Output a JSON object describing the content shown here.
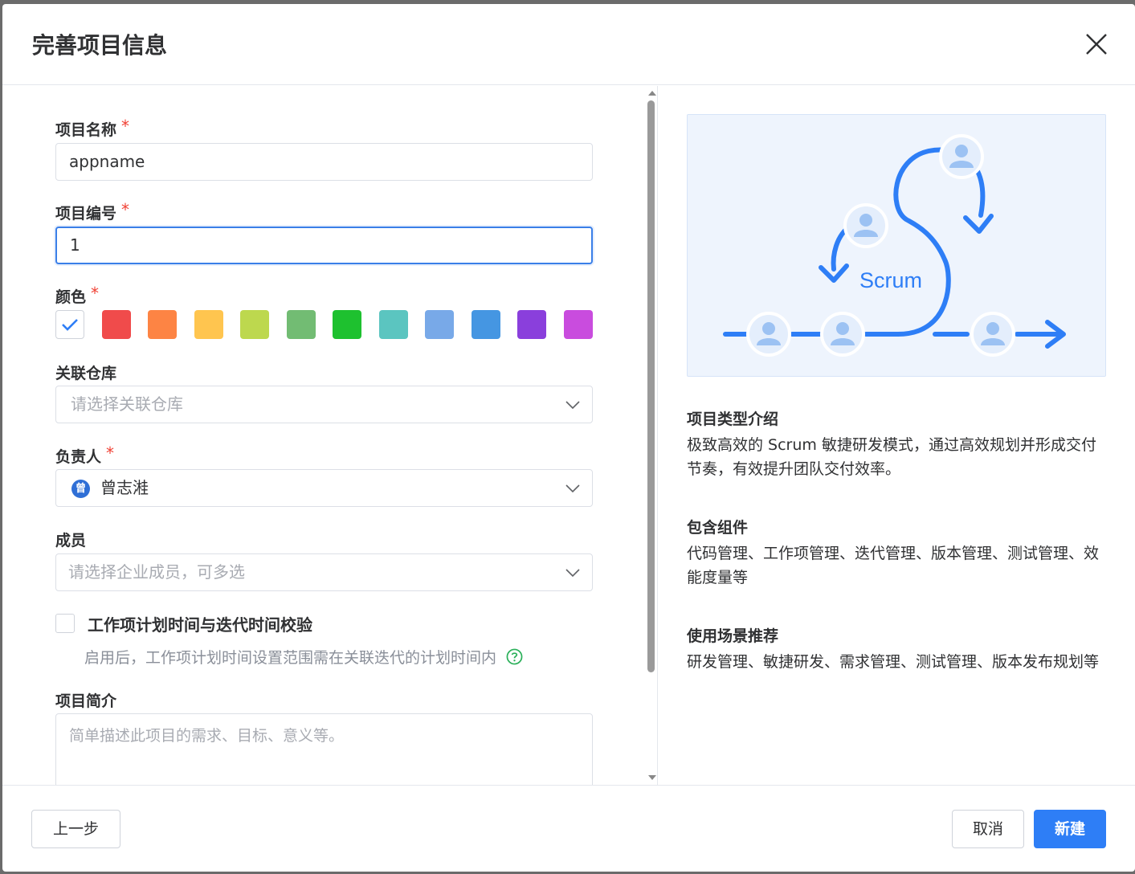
{
  "dialog": {
    "title": "完善项目信息"
  },
  "form": {
    "name": {
      "label": "项目名称",
      "required": "*",
      "value": "appname"
    },
    "code": {
      "label": "项目编号",
      "required": "*",
      "value": "1"
    },
    "color": {
      "label": "颜色",
      "required": "*",
      "selected": "none",
      "swatches": [
        "#f04b4b",
        "#fd8444",
        "#ffc54f",
        "#bdd84e",
        "#72bc73",
        "#1ec12f",
        "#5bc5c0",
        "#78a9e8",
        "#4596e2",
        "#8a3fdc",
        "#c94cde"
      ]
    },
    "repo": {
      "label": "关联仓库",
      "placeholder": "请选择关联仓库"
    },
    "owner": {
      "label": "负责人",
      "required": "*",
      "avatar": "曾",
      "value": "曾志溎"
    },
    "members": {
      "label": "成员",
      "placeholder": "请选择企业成员，可多选"
    },
    "validate": {
      "label": "工作项计划时间与迭代时间校验",
      "help": "启用后，工作项计划时间设置范围需在关联迭代的计划时间内"
    },
    "desc": {
      "label": "项目简介",
      "placeholder": "简单描述此项目的需求、目标、意义等。"
    }
  },
  "info": {
    "illustration_label": "Scrum",
    "sections": [
      {
        "title": "项目类型介绍",
        "body": "极致高效的 Scrum 敏捷研发模式，通过高效规划并形成交付节奏，有效提升团队交付效率。"
      },
      {
        "title": "包含组件",
        "body": "代码管理、工作项管理、迭代管理、版本管理、测试管理、效能度量等"
      },
      {
        "title": "使用场景推荐",
        "body": "研发管理、敏捷研发、需求管理、测试管理、版本发布规划等"
      }
    ]
  },
  "footer": {
    "prev": "上一步",
    "cancel": "取消",
    "create": "新建"
  },
  "colors": {
    "primary": "#2e7ef6",
    "required": "#f04134",
    "illustration": "#2e7ef6"
  }
}
